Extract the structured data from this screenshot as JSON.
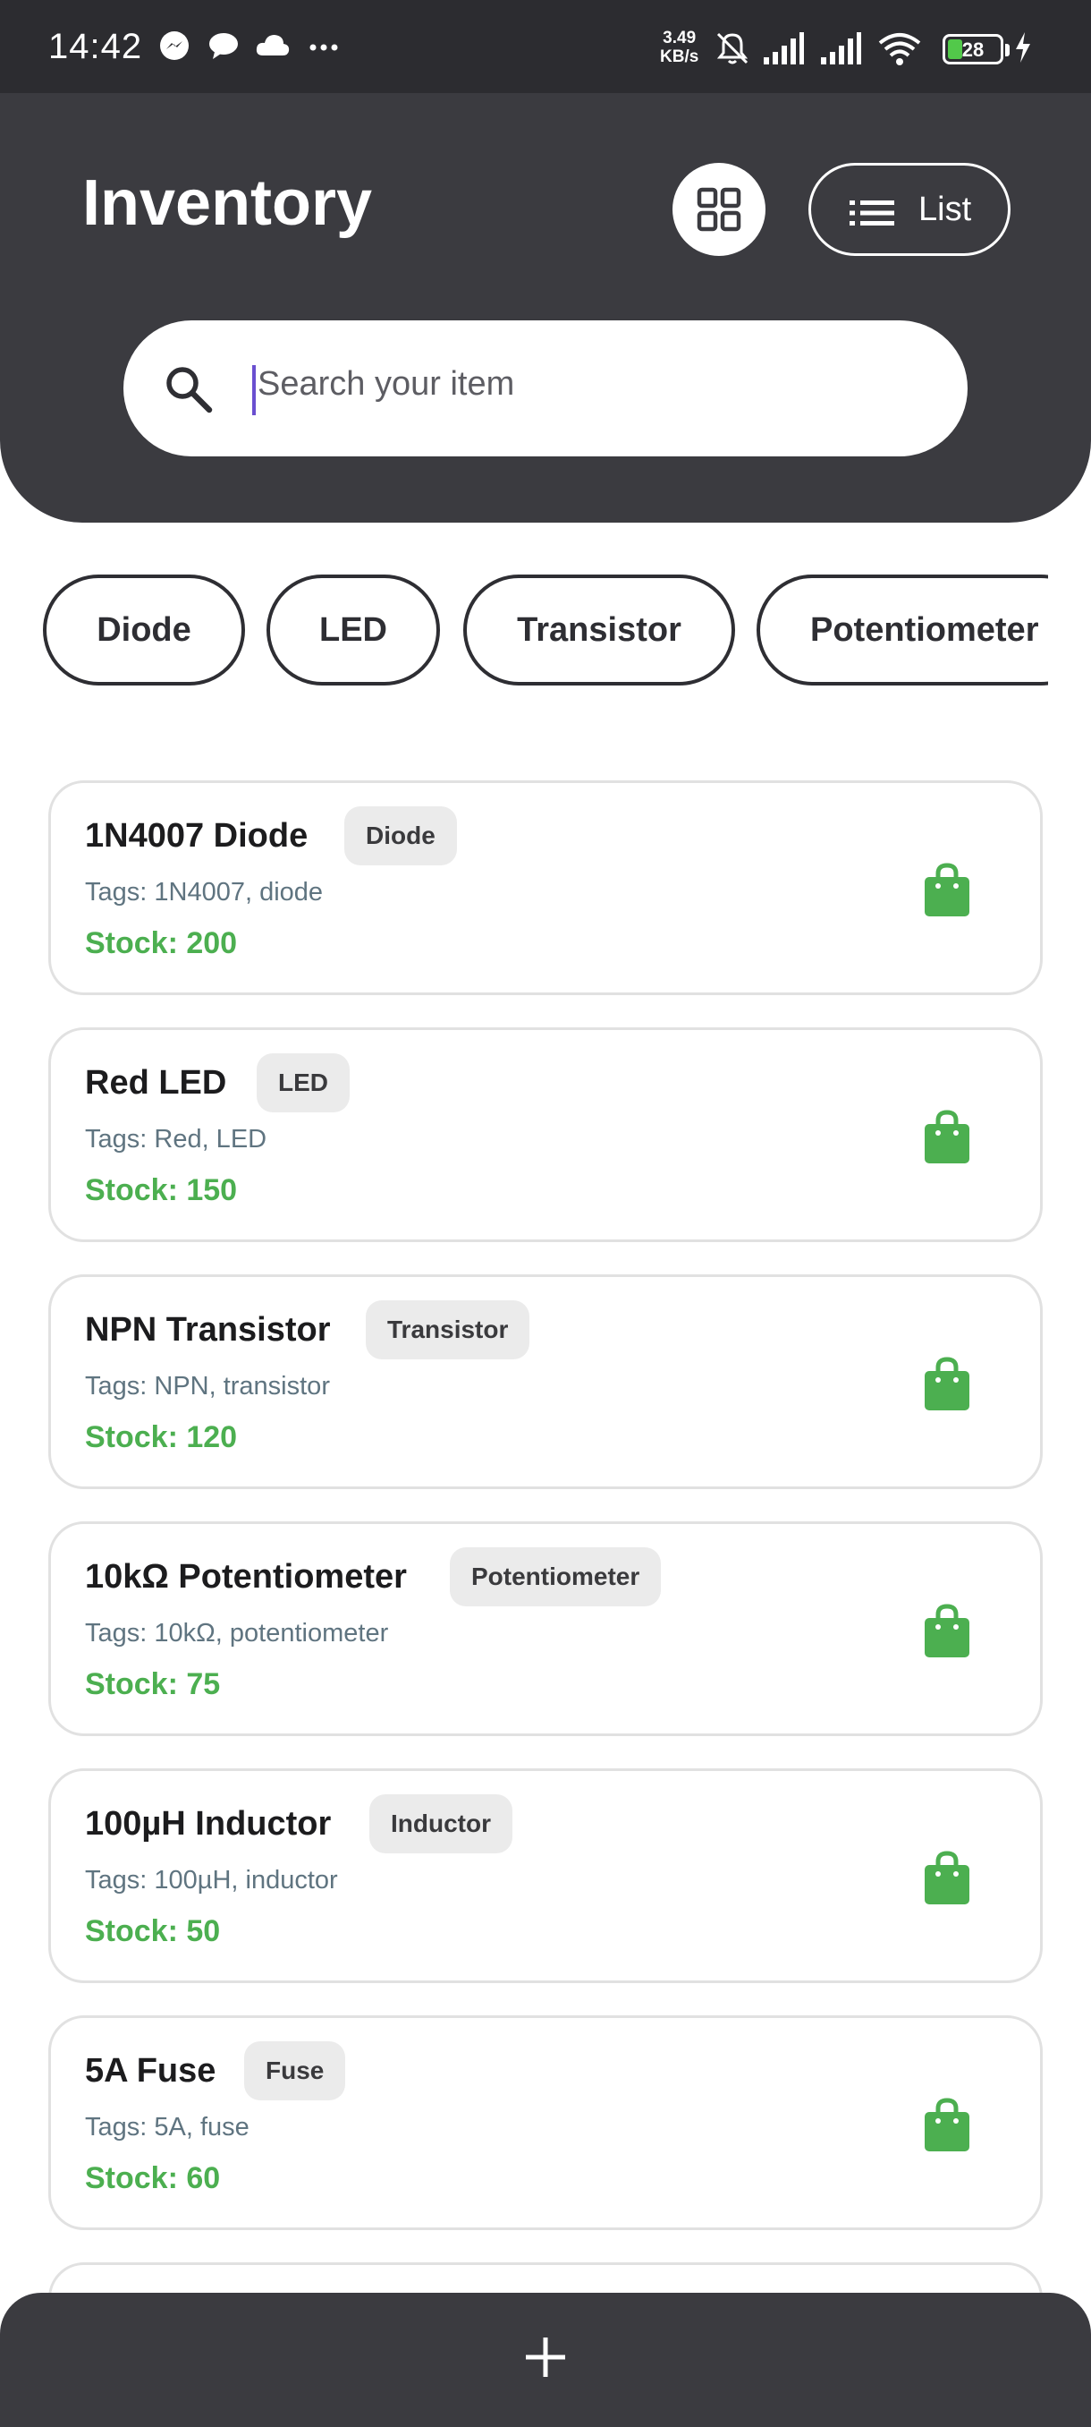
{
  "status_bar": {
    "time": "14:42",
    "net_speed_value": "3.49",
    "net_speed_unit": "KB/s",
    "battery": "28",
    "icons": [
      "messenger-icon",
      "chat-icon",
      "cloud-icon",
      "more-dots-icon",
      "mute-bell-icon",
      "signal-icon",
      "signal-icon",
      "wifi-icon",
      "charging-icon"
    ]
  },
  "header": {
    "title": "Inventory",
    "grid_view_icon": "grid-icon",
    "list_label": "List",
    "list_icon": "list-icon"
  },
  "search": {
    "placeholder": "Search your item",
    "icon": "search-icon"
  },
  "categories": [
    "Diode",
    "LED",
    "Transistor",
    "Potentiometer"
  ],
  "items": [
    {
      "name": "1N4007 Diode",
      "category": "Diode",
      "tags": "Tags: 1N4007, diode",
      "stock": "Stock: 200"
    },
    {
      "name": "Red LED",
      "category": "LED",
      "tags": "Tags: Red, LED",
      "stock": "Stock: 150"
    },
    {
      "name": "NPN Transistor",
      "category": "Transistor",
      "tags": "Tags: NPN, transistor",
      "stock": "Stock: 120"
    },
    {
      "name": "10kΩ Potentiometer",
      "category": "Potentiometer",
      "tags": "Tags: 10kΩ, potentiometer",
      "stock": "Stock: 75"
    },
    {
      "name": "100µH Inductor",
      "category": "Inductor",
      "tags": "Tags: 100µH, inductor",
      "stock": "Stock: 50"
    },
    {
      "name": "5A Fuse",
      "category": "Fuse",
      "tags": "Tags: 5A, fuse",
      "stock": "Stock: 60"
    }
  ],
  "bottom_bar": {
    "add_icon": "plus-icon"
  },
  "colors": {
    "header_bg": "#3b3b40",
    "status_bg": "#2c2c30",
    "stock_green": "#4caf50",
    "tags_gray": "#5f7480",
    "badge_bg": "#ebebeb",
    "caret": "#6a4fd0"
  }
}
